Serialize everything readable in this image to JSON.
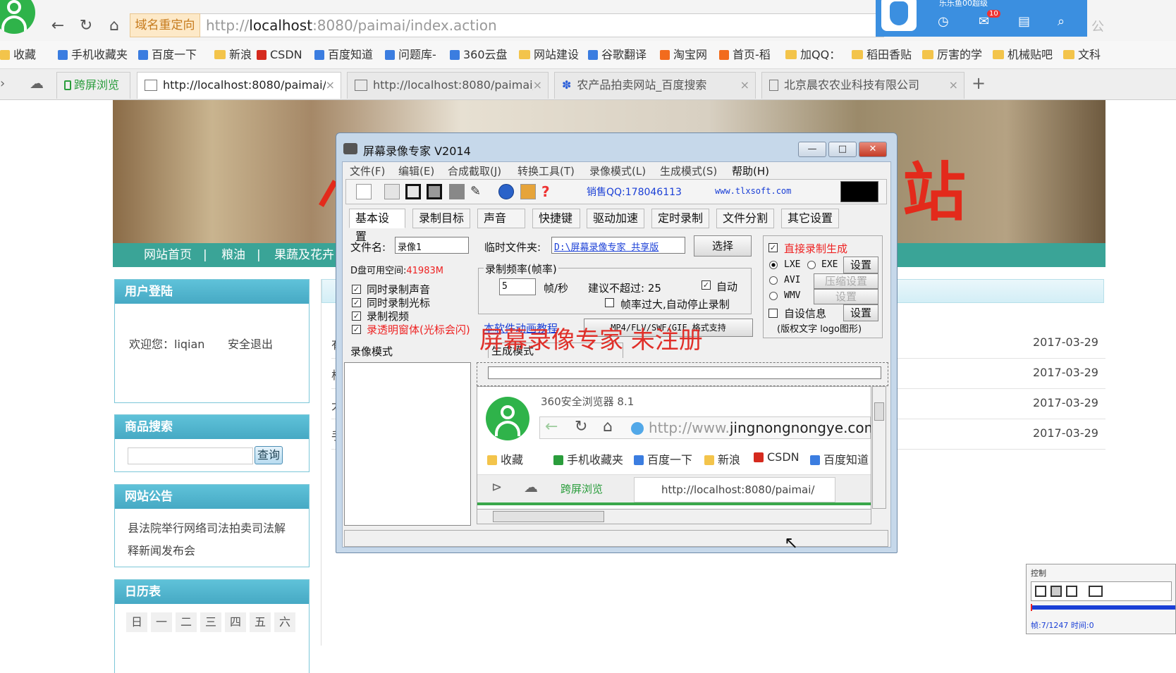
{
  "browser": {
    "title": "360安全浏览器 8.1",
    "redirect_label": "域名重定向",
    "url_prefix": "http://",
    "url_host": "localhost",
    "url_path": ":8080/paimai/index.action",
    "user_notice": "乐乐鱼00超级",
    "mail_badge": "10",
    "corner_text": "公",
    "bookmarks": [
      "收藏",
      "手机收藏夹",
      "百度一下",
      "新浪",
      "CSDN",
      "百度知道",
      "问题库-",
      "360云盘",
      "网站建设",
      "谷歌翻译",
      "淘宝网",
      "首页-稻",
      "加QQ：",
      "稻田香贴",
      "厉害的学",
      "机械贴吧",
      "文科"
    ],
    "tabs": [
      {
        "label": "跨屏浏览"
      },
      {
        "label": "http://localhost:8080/paimai/"
      },
      {
        "label": "http://localhost:8080/paimai/"
      },
      {
        "label": "农产品拍卖网站_百度搜索"
      },
      {
        "label": "北京晨农农业科技有限公司"
      }
    ],
    "new_tab": "+"
  },
  "site": {
    "banner_char": "站",
    "nav": [
      "网站首页",
      "|",
      "粮油",
      "|",
      "果蔬及花卉"
    ],
    "login": {
      "title": "用户登陆",
      "welcome": "欢迎您：liqian",
      "logout": "安全退出"
    },
    "search": {
      "title": "商品搜索",
      "button": "查询",
      "placeholder": ""
    },
    "notice": {
      "title": "网站公告",
      "text": "县法院举行网络司法拍卖司法解释新闻发布会"
    },
    "calendar": {
      "title": "日历表",
      "days": [
        "日",
        "一",
        "二",
        "三",
        "四",
        "五",
        "六"
      ]
    },
    "news_dates": [
      "2017-03-29",
      "2017-03-29",
      "2017-03-29",
      "2017-03-29"
    ],
    "news_initials": [
      "有",
      "析",
      "大",
      "手"
    ]
  },
  "recorder": {
    "title": "屏幕录像专家 V2014",
    "menus": [
      "文件(F)",
      "编辑(E)",
      "合成截取(J)",
      "转换工具(T)",
      "录像模式(L)",
      "生成模式(S)",
      "帮助(H)"
    ],
    "qq": "销售QQ:178046113",
    "website": "www.tlxsoft.com",
    "tabs": [
      "基本设置",
      "录制目标",
      "声音",
      "快捷键",
      "驱动加速",
      "定时录制",
      "文件分割",
      "其它设置"
    ],
    "filename_label": "文件名:",
    "filename_value": "录像1",
    "tempdir_label": "临时文件夹:",
    "tempdir_value": "D:\\屏幕录像专家 共享版 ",
    "select_btn": "选择",
    "disk_label": "D盘可用空间:",
    "disk_value": "41983M",
    "checks": [
      "同时录制声音",
      "同时录制光标",
      "录制视频",
      "录透明窗体(光标会闪)"
    ],
    "fps_group": "录制频率(帧率)",
    "fps_value": "5",
    "fps_unit": "帧/秒",
    "suggest": "建议不超过: 25",
    "auto": "自动",
    "stop_label": "帧率过大,自动停止录制",
    "tutorial_link": "本软件动画教程",
    "format_btn": "MP4/FLV/SWF/GIF 格式支持",
    "direct_gen": "直接录制生成",
    "fmt_lxe": "LXE",
    "fmt_exe": "EXE",
    "fmt_avi": "AVI",
    "fmt_wmv": "WMV",
    "set_btn": "设置",
    "compress_btn": "压缩设置",
    "custom_info": "自设信息",
    "custom_note": "(版权文字 logo图形)",
    "mode_label": "录像模式",
    "gen_mode_label": "生成模式",
    "watermark": "屏幕录像专家  未注册",
    "minimize": "—",
    "maximize": "□",
    "close": "✕"
  },
  "preview": {
    "title": "360安全浏览器 8.1",
    "url_prefix": "http://www.",
    "url_host": "jingnongnongye.com",
    "bookmarks": [
      "收藏",
      "手机收藏夹",
      "百度一下",
      "新浪",
      "CSDN",
      "百度知道"
    ],
    "tab1": "跨屏浏览",
    "tab2": "http://localhost:8080/paimai/"
  },
  "control": {
    "title": "控制",
    "status": "帧:7/1247 时间:0",
    "progress": 0.01
  }
}
